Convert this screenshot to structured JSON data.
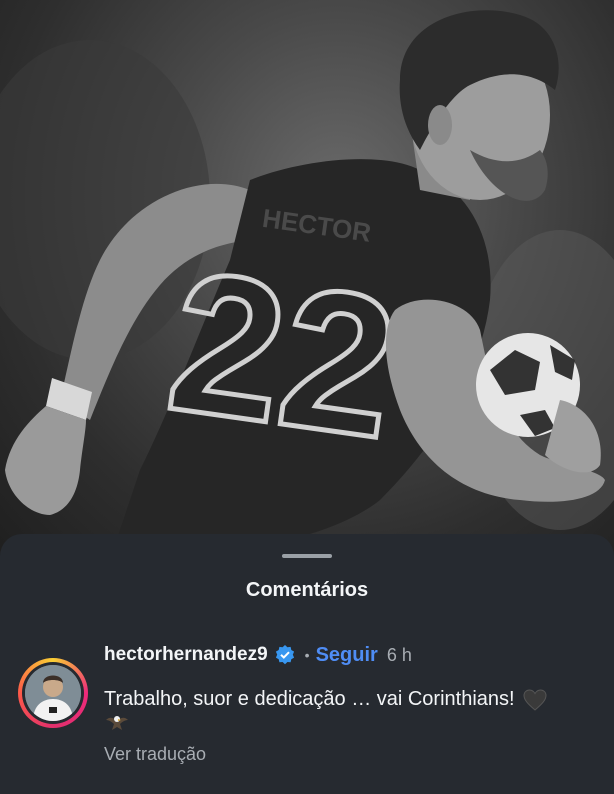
{
  "sheet": {
    "title": "Comentários"
  },
  "comment": {
    "username": "hectorhernandez9",
    "verified": true,
    "separator": "•",
    "follow_label": "Seguir",
    "time": "6 h",
    "text": "Trabalho, suor e dedicação … vai Corinthians!",
    "emojis": [
      "black-heart-icon",
      "eagle-icon"
    ],
    "translate_label": "Ver tradução"
  },
  "photo": {
    "jersey_number": "22",
    "jersey_name": "HECTOR"
  },
  "colors": {
    "sheet_bg": "#262a30",
    "follow": "#4f8df5",
    "verified": "#3897f0",
    "muted_text": "#a8adb3"
  }
}
